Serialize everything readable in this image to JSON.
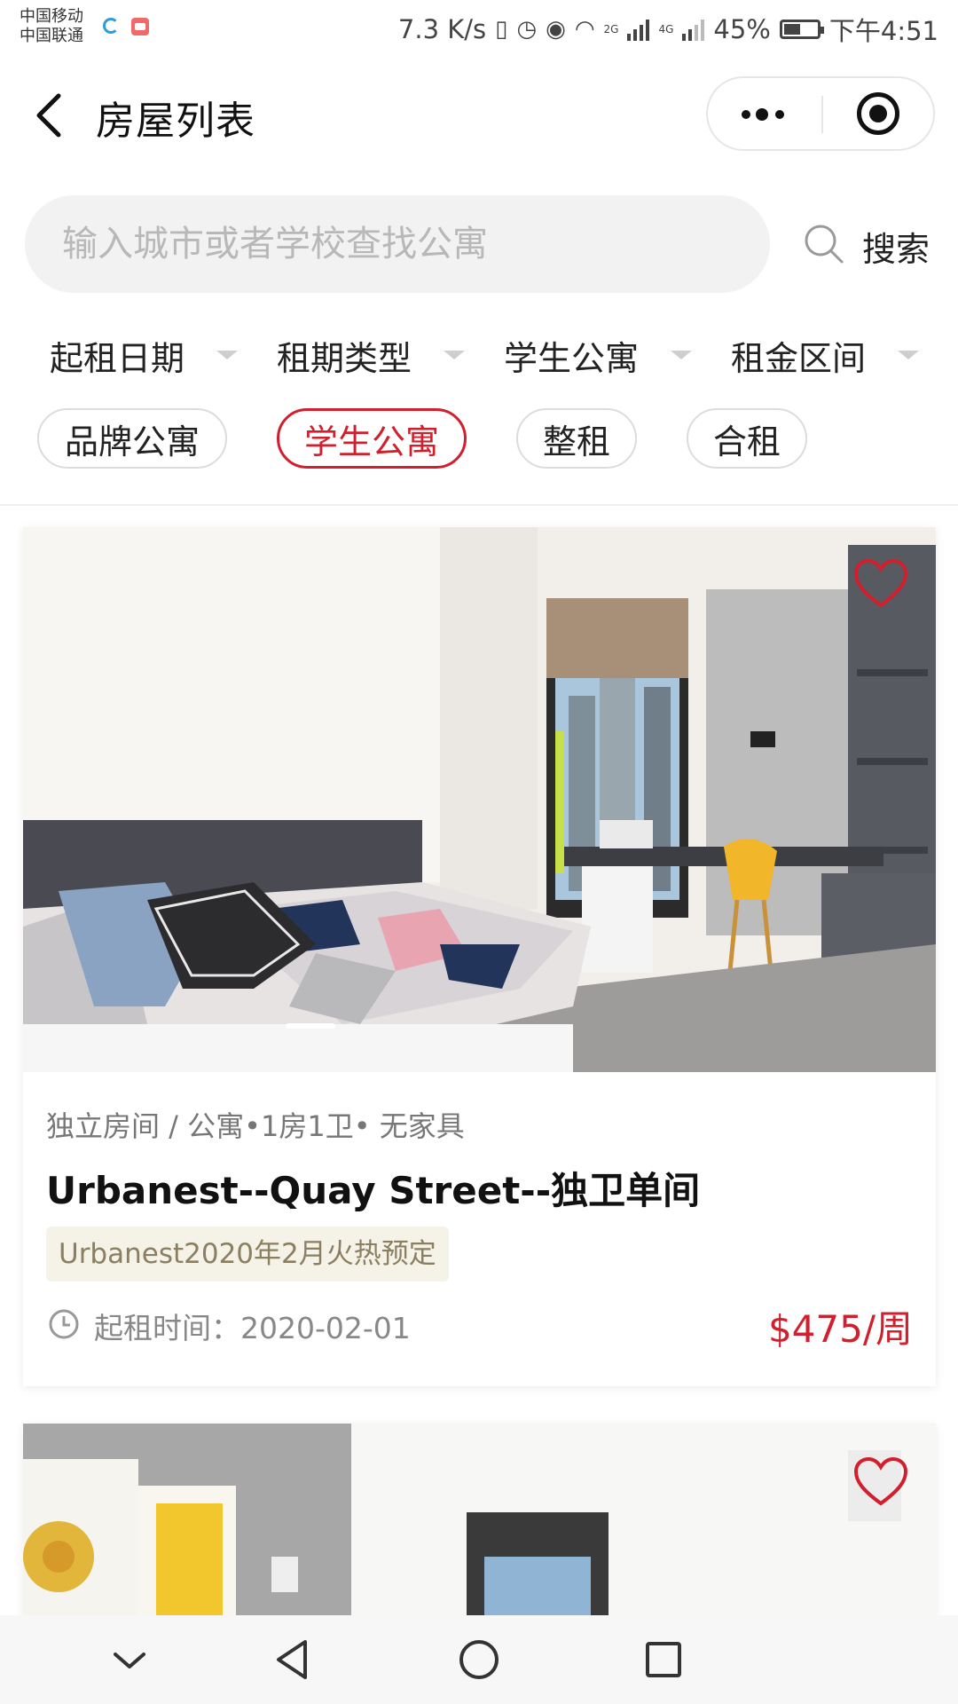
{
  "status_bar": {
    "carrier_1": "中国移动",
    "carrier_2": "中国联通",
    "net_speed": "7.3 K/s",
    "network_1": "2G",
    "network_2": "4G",
    "battery": "45%",
    "time": "下午4:51"
  },
  "header": {
    "title": "房屋列表"
  },
  "search": {
    "placeholder": "输入城市或者学校查找公寓",
    "button_label": "搜索"
  },
  "filters": [
    {
      "label": "起租日期"
    },
    {
      "label": "租期类型"
    },
    {
      "label": "学生公寓"
    },
    {
      "label": "租金区间"
    }
  ],
  "tags": [
    {
      "label": "品牌公寓",
      "active": false
    },
    {
      "label": "学生公寓",
      "active": true
    },
    {
      "label": "整租",
      "active": false
    },
    {
      "label": "合租",
      "active": false
    }
  ],
  "listings": [
    {
      "meta": "独立房间 / 公寓•1房1卫• 无家具",
      "name": "Urbanest--Quay Street--独卫单间",
      "promo": "Urbanest2020年2月火热预定",
      "start_date": "起租时间：2020-02-01",
      "price": "$475/周",
      "favorite": false
    },
    {
      "favorite": false
    }
  ],
  "colors": {
    "accent": "#d21f2d",
    "promo_bg": "#f5f2e8",
    "search_bg": "#f2f2f2"
  },
  "icons": {
    "back": "back-arrow-icon",
    "more": "more-dots-icon",
    "close": "target-close-icon",
    "search": "search-icon",
    "favorite": "heart-outline-icon",
    "clock": "clock-icon",
    "nav": [
      "chevron-down-icon",
      "triangle-back-icon",
      "circle-home-icon",
      "square-recents-icon"
    ]
  }
}
